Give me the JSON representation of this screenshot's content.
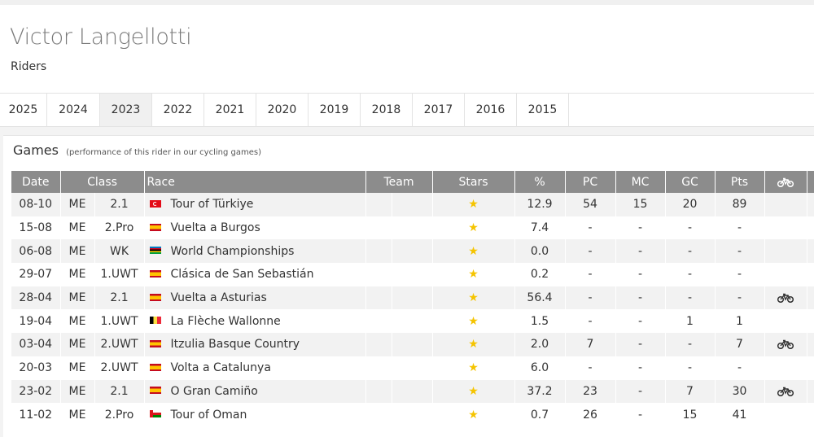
{
  "rider": {
    "name": "Victor Langellotti",
    "subtitle": "Riders"
  },
  "years": [
    {
      "label": "2025",
      "active": false
    },
    {
      "label": "2024",
      "active": false
    },
    {
      "label": "2023",
      "active": true
    },
    {
      "label": "2022",
      "active": false
    },
    {
      "label": "2021",
      "active": false
    },
    {
      "label": "2020",
      "active": false
    },
    {
      "label": "2019",
      "active": false
    },
    {
      "label": "2018",
      "active": false
    },
    {
      "label": "2017",
      "active": false
    },
    {
      "label": "2016",
      "active": false
    },
    {
      "label": "2015",
      "active": false
    }
  ],
  "games": {
    "title": "Games",
    "note": "(performance of this rider in our cycling games)",
    "columns": [
      "Date",
      "Class",
      "",
      "Race",
      "Team",
      "Stars",
      "%",
      "PC",
      "MC",
      "GC",
      "Pts",
      "bike-icon",
      ""
    ],
    "rows": [
      {
        "date": "08-10",
        "class": "ME",
        "cat": "2.1",
        "flag": "tr",
        "race": "Tour of Türkiye",
        "stars": "★",
        "pct": "12.9",
        "pc": "54",
        "mc": "15",
        "gc": "20",
        "pts": "89",
        "bike": false
      },
      {
        "date": "15-08",
        "class": "ME",
        "cat": "2.Pro",
        "flag": "es",
        "race": "Vuelta a Burgos",
        "stars": "★",
        "pct": "7.4",
        "pc": "-",
        "mc": "-",
        "gc": "-",
        "pts": "-",
        "bike": false
      },
      {
        "date": "06-08",
        "class": "ME",
        "cat": "WK",
        "flag": "uci",
        "race": "World Championships",
        "stars": "★",
        "pct": "0.0",
        "pc": "-",
        "mc": "-",
        "gc": "-",
        "pts": "-",
        "bike": false
      },
      {
        "date": "29-07",
        "class": "ME",
        "cat": "1.UWT",
        "flag": "es",
        "race": "Clásica de San Sebastián",
        "stars": "★",
        "pct": "0.2",
        "pc": "-",
        "mc": "-",
        "gc": "-",
        "pts": "-",
        "bike": false
      },
      {
        "date": "28-04",
        "class": "ME",
        "cat": "2.1",
        "flag": "es",
        "race": "Vuelta a Asturias",
        "stars": "★",
        "pct": "56.4",
        "pc": "-",
        "mc": "-",
        "gc": "-",
        "pts": "-",
        "bike": true
      },
      {
        "date": "19-04",
        "class": "ME",
        "cat": "1.UWT",
        "flag": "be",
        "race": "La Flèche Wallonne",
        "stars": "★",
        "pct": "1.5",
        "pc": "-",
        "mc": "-",
        "gc": "1",
        "pts": "1",
        "bike": false
      },
      {
        "date": "03-04",
        "class": "ME",
        "cat": "2.UWT",
        "flag": "es",
        "race": "Itzulia Basque Country",
        "stars": "★",
        "pct": "2.0",
        "pc": "7",
        "mc": "-",
        "gc": "-",
        "pts": "7",
        "bike": true
      },
      {
        "date": "20-03",
        "class": "ME",
        "cat": "2.UWT",
        "flag": "es",
        "race": "Volta a Catalunya",
        "stars": "★",
        "pct": "6.0",
        "pc": "-",
        "mc": "-",
        "gc": "-",
        "pts": "-",
        "bike": false
      },
      {
        "date": "23-02",
        "class": "ME",
        "cat": "2.1",
        "flag": "es",
        "race": "O Gran Camiño",
        "stars": "★",
        "pct": "37.2",
        "pc": "23",
        "mc": "-",
        "gc": "7",
        "pts": "30",
        "bike": true
      },
      {
        "date": "11-02",
        "class": "ME",
        "cat": "2.Pro",
        "flag": "om",
        "race": "Tour of Oman",
        "stars": "★",
        "pct": "0.7",
        "pc": "26",
        "mc": "-",
        "gc": "15",
        "pts": "41",
        "bike": false
      }
    ]
  },
  "colors": {
    "header_bg": "#8c8c8c",
    "star": "#f5c400",
    "row_alt": "#f2f2f2"
  }
}
